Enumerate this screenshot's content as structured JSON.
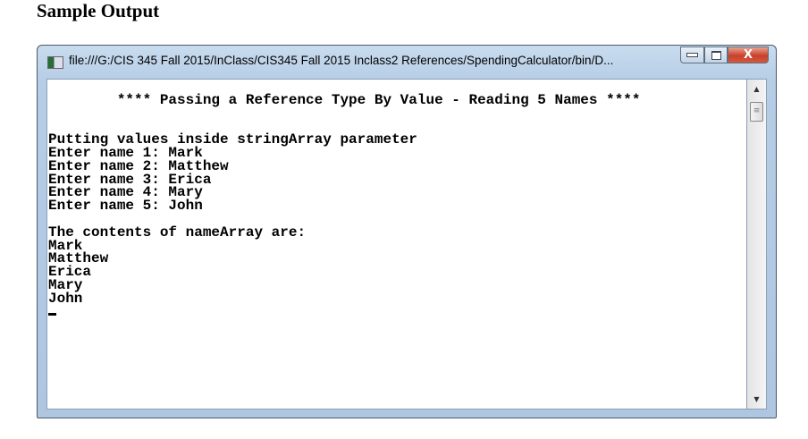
{
  "page": {
    "heading": "Sample Output"
  },
  "window": {
    "title": "file:///G:/CIS 345 Fall 2015/InClass/CIS345 Fall 2015 Inclass2 References/SpendingCalculator/bin/D...",
    "controls": {
      "minimize": "▭",
      "maximize": "▣",
      "close": "X"
    },
    "icons": {
      "app": "console-app-icon",
      "minimize": "minimize-icon",
      "maximize": "maximize-icon",
      "close": "close-icon"
    }
  },
  "console": {
    "lines": [
      "",
      "        **** Passing a Reference Type By Value - Reading 5 Names ****",
      "",
      "",
      "Putting values inside stringArray parameter",
      "Enter name 1: Mark",
      "Enter name 2: Matthew",
      "Enter name 3: Erica",
      "Enter name 4: Mary",
      "Enter name 5: John",
      "",
      "The contents of nameArray are:",
      "Mark",
      "Matthew",
      "Erica",
      "Mary",
      "John"
    ]
  },
  "scrollbar": {
    "up": "▲",
    "down": "▼",
    "thumb": "≡"
  }
}
